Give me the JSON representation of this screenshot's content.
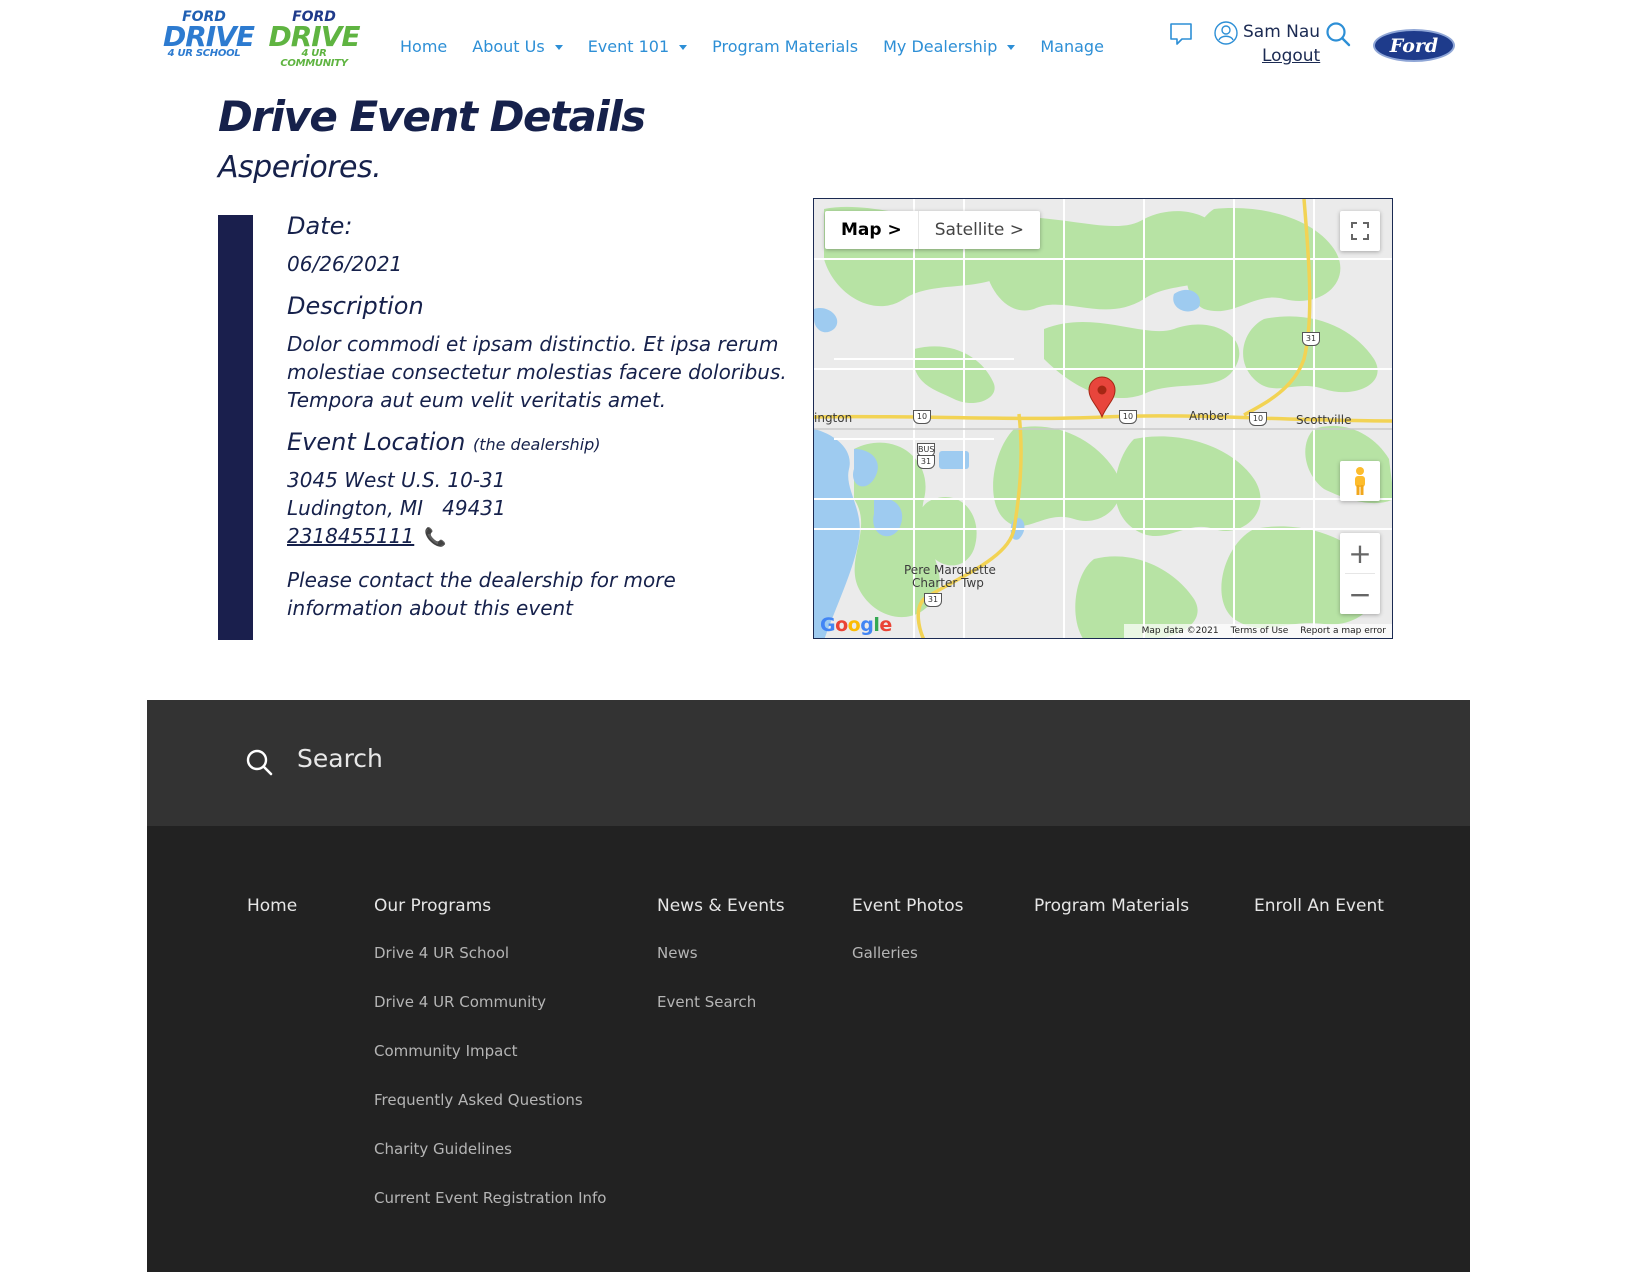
{
  "header": {
    "logo_school": {
      "line1": "FORD",
      "line2": "DRIVE",
      "line3": "4 UR SCHOOL"
    },
    "logo_community": {
      "line1": "FORD",
      "line2": "DRIVE",
      "line3": "4 UR COMMUNITY"
    },
    "nav": [
      {
        "label": "Home",
        "dropdown": false
      },
      {
        "label": "About Us",
        "dropdown": true
      },
      {
        "label": "Event 101",
        "dropdown": true
      },
      {
        "label": "Program Materials",
        "dropdown": false
      },
      {
        "label": "My Dealership",
        "dropdown": true
      },
      {
        "label": "Manage",
        "dropdown": false
      }
    ],
    "user_name": "Sam Nau",
    "logout_label": "Logout",
    "brand_logo": "Ford",
    "nav_color": "#2d8fd6",
    "icons": [
      "chat-icon",
      "user-icon",
      "search-icon"
    ]
  },
  "event": {
    "page_title": "Drive Event Details",
    "event_name": "Asperiores.",
    "date_label": "Date:",
    "date_value": "06/26/2021",
    "description_label": "Description",
    "description_text": "Dolor commodi et ipsam distinctio. Et ipsa rerum molestiae consectetur molestias facere doloribus. Tempora aut eum velit veritatis amet.",
    "location_label": "Event Location",
    "location_note": "(the dealership)",
    "address_line1": "3045 West U.S. 10-31",
    "address_line2": "Ludington, MI   49431",
    "phone": "2318455111",
    "contact_note": "Please contact the dealership for more information about this event"
  },
  "map": {
    "type_buttons": {
      "map": "Map >",
      "satellite": "Satellite >"
    },
    "place_labels": {
      "ludington": "ington",
      "amber": "Amber",
      "scottville": "Scottville",
      "pere_marquette_1": "Pere Marquette",
      "pere_marquette_2": "Charter Twp"
    },
    "route_shields": [
      "10",
      "10",
      "10",
      "10",
      "31",
      "31",
      "31",
      "BUS"
    ],
    "footer": {
      "data": "Map data ©2021",
      "terms": "Terms of Use",
      "report": "Report a map error"
    },
    "google": "Google",
    "zoom_in": "+",
    "zoom_out": "−"
  },
  "footer": {
    "search_placeholder": "Search",
    "columns": [
      {
        "heading": "Home",
        "links": []
      },
      {
        "heading": "Our Programs",
        "links": [
          "Drive 4 UR School",
          "Drive 4 UR Community",
          "Community Impact",
          "Frequently Asked Questions",
          "Charity Guidelines",
          "Current Event Registration Info"
        ]
      },
      {
        "heading": "News & Events",
        "links": [
          "News",
          "Event Search"
        ]
      },
      {
        "heading": "Event Photos",
        "links": [
          "Galleries"
        ]
      },
      {
        "heading": "Program Materials",
        "links": []
      },
      {
        "heading": "Enroll An Event",
        "links": []
      }
    ]
  }
}
